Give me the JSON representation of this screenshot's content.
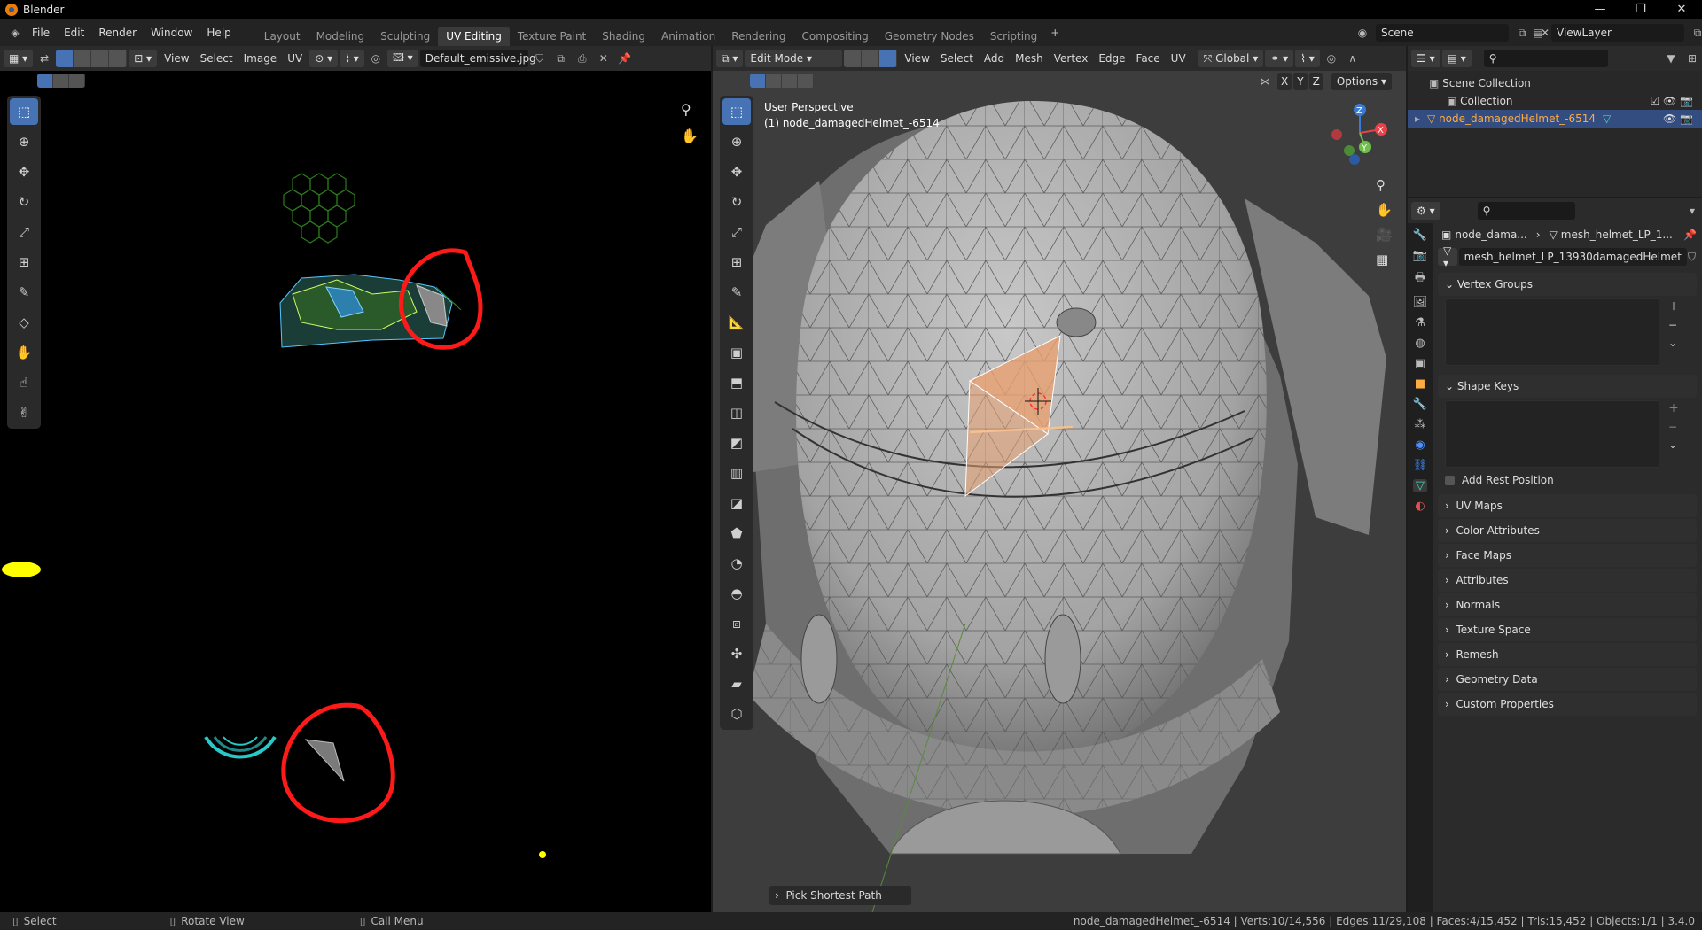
{
  "app": {
    "title": "Blender"
  },
  "menus": [
    "File",
    "Edit",
    "Render",
    "Window",
    "Help"
  ],
  "workspaces": [
    {
      "label": "Layout"
    },
    {
      "label": "Modeling"
    },
    {
      "label": "Sculpting"
    },
    {
      "label": "UV Editing",
      "active": true
    },
    {
      "label": "Texture Paint"
    },
    {
      "label": "Shading"
    },
    {
      "label": "Animation"
    },
    {
      "label": "Rendering"
    },
    {
      "label": "Compositing"
    },
    {
      "label": "Geometry Nodes"
    },
    {
      "label": "Scripting"
    }
  ],
  "scene": {
    "name": "Scene",
    "view_layer": "ViewLayer"
  },
  "uv_editor": {
    "menus": [
      "View",
      "Select",
      "Image",
      "UV"
    ],
    "image_name": "Default_emissive.jpg",
    "tools": [
      "select-box",
      "cursor",
      "move",
      "rotate",
      "scale",
      "transform",
      "annotate",
      "rip",
      "grab",
      "relax",
      "pinch"
    ]
  },
  "viewport": {
    "mode": "Edit Mode",
    "menus": [
      "View",
      "Select",
      "Add",
      "Mesh",
      "Vertex",
      "Edge",
      "Face",
      "UV"
    ],
    "orientation": "Global",
    "options_label": "Options",
    "axes": [
      "X",
      "Y",
      "Z"
    ],
    "overlay_title": "User Perspective",
    "overlay_object": "(1) node_damagedHelmet_-6514",
    "operator_panel": "Pick Shortest Path"
  },
  "outliner": {
    "scene_collection": "Scene Collection",
    "collection": "Collection",
    "object": "node_damagedHelmet_-6514"
  },
  "properties": {
    "breadcrumb_object": "node_dama...",
    "breadcrumb_mesh": "mesh_helmet_LP_1...",
    "mesh_name": "mesh_helmet_LP_13930damagedHelmet",
    "sections": {
      "vertex_groups": "Vertex Groups",
      "shape_keys": "Shape Keys",
      "add_rest_position": "Add Rest Position"
    },
    "collapsed": [
      "UV Maps",
      "Color Attributes",
      "Face Maps",
      "Attributes",
      "Normals",
      "Texture Space",
      "Remesh",
      "Geometry Data",
      "Custom Properties"
    ]
  },
  "statusbar": {
    "select": "Select",
    "rotate": "Rotate View",
    "call_menu": "Call Menu",
    "stats": "node_damagedHelmet_-6514 | Verts:10/14,556 | Edges:11/29,108 | Faces:4/15,452 | Tris:15,452 | Objects:1/1 | 3.4.0"
  },
  "colors": {
    "accent": "#4772b3",
    "selection": "#e8a070",
    "annotation_red": "#ff1a1a",
    "annotation_yellow": "#ffff00",
    "object_highlight": "#ffaa40"
  }
}
